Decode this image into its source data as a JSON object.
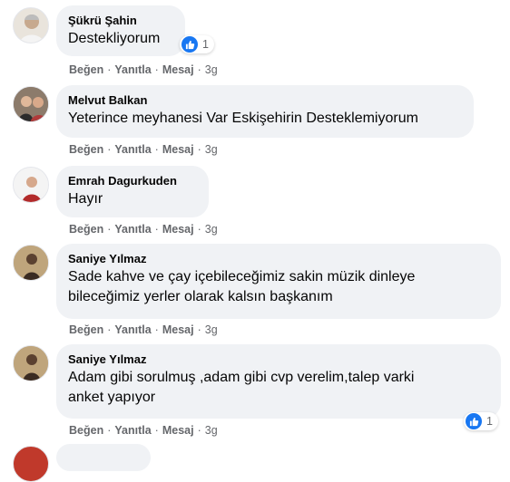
{
  "comments": [
    {
      "author": "Şükrü Şahin",
      "lines": [
        "Destekliyorum"
      ],
      "like": "Beğen",
      "reply": "Yanıtla",
      "message": "Mesaj",
      "time": "3g",
      "reaction_count": "1"
    },
    {
      "author": "Melvut Balkan",
      "lines": [
        "Yeterince meyhanesi Var Eskişehirin Desteklemiyorum"
      ],
      "like": "Beğen",
      "reply": "Yanıtla",
      "message": "Mesaj",
      "time": "3g"
    },
    {
      "author": "Emrah Dagurkuden",
      "lines": [
        "Hayır"
      ],
      "like": "Beğen",
      "reply": "Yanıtla",
      "message": "Mesaj",
      "time": "3g"
    },
    {
      "author": "Saniye Yılmaz",
      "lines": [
        "Sade kahve ve çay içebileceğimiz sakin müzik dinleye",
        "bileceğimiz yerler olarak kalsın başkanım"
      ],
      "like": "Beğen",
      "reply": "Yanıtla",
      "message": "Mesaj",
      "time": "3g"
    },
    {
      "author": "Saniye Yılmaz",
      "lines": [
        "Adam gibi sorulmuş ,adam gibi cvp verelim,talep varki",
        "anket yapıyor"
      ],
      "like": "Beğen",
      "reply": "Yanıtla",
      "message": "Mesaj",
      "time": "3g",
      "reaction_count": "1"
    }
  ],
  "colors": {
    "bubble": "#f0f2f5",
    "meta": "#65676b",
    "like_blue": "#1877f2"
  },
  "icons": {
    "reaction": "thumbs-up-icon",
    "avatar": "avatar-photo"
  }
}
